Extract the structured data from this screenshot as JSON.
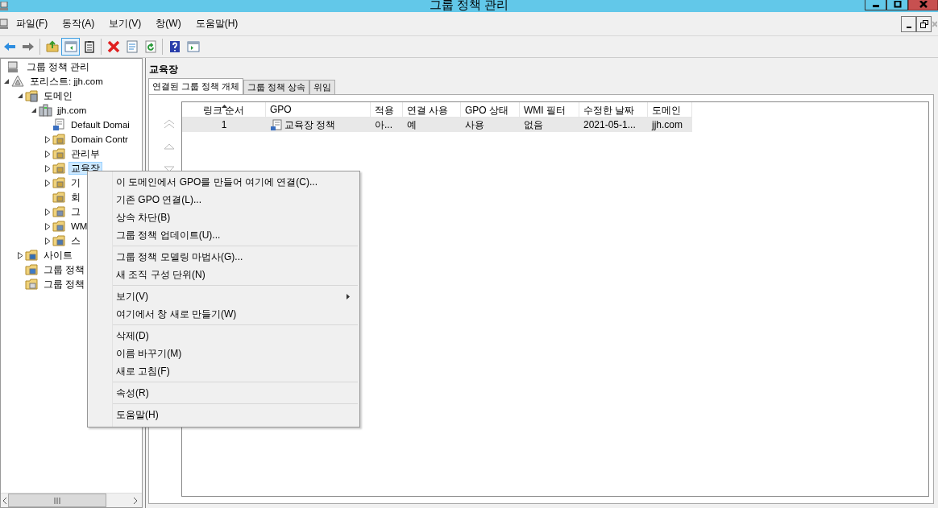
{
  "window": {
    "title": "그룹 정책 관리"
  },
  "menu_bar": [
    "파일(F)",
    "동작(A)",
    "보기(V)",
    "창(W)",
    "도움말(H)"
  ],
  "toolbar": [
    {
      "kind": "back",
      "pressed": false
    },
    {
      "kind": "forward",
      "pressed": false
    },
    {
      "kind": "separator"
    },
    {
      "kind": "folder-up",
      "pressed": false
    },
    {
      "kind": "tree-pane",
      "pressed": true
    },
    {
      "kind": "clipboard",
      "pressed": false
    },
    {
      "kind": "separator"
    },
    {
      "kind": "delete",
      "pressed": false
    },
    {
      "kind": "properties",
      "pressed": false
    },
    {
      "kind": "refresh",
      "pressed": false
    },
    {
      "kind": "separator"
    },
    {
      "kind": "help",
      "pressed": false
    },
    {
      "kind": "action-pane",
      "pressed": false
    }
  ],
  "tree": [
    {
      "label": "그룹 정책 관리",
      "kind": "console",
      "selected": false,
      "children": [
        {
          "label": "포리스트: jjh.com",
          "kind": "forest",
          "selected": false,
          "expanded": true,
          "children": [
            {
              "label": "도메인",
              "kind": "domains",
              "selected": false,
              "expanded": true,
              "children": [
                {
                  "label": "jjh.com",
                  "kind": "domain",
                  "selected": false,
                  "expanded": true,
                  "children": [
                    {
                      "label": "Default Domai",
                      "kind": "gpo-link",
                      "selected": false
                    },
                    {
                      "label": "Domain Contr",
                      "kind": "ou",
                      "selected": false,
                      "expanded": false
                    },
                    {
                      "label": "관리부",
                      "kind": "ou",
                      "selected": false,
                      "expanded": false
                    },
                    {
                      "label": "교육장",
                      "kind": "ou",
                      "selected": true,
                      "expanded": false
                    },
                    {
                      "label": "기",
                      "kind": "ou",
                      "selected": false,
                      "expanded": false
                    },
                    {
                      "label": "회",
                      "kind": "ou",
                      "selected": false
                    },
                    {
                      "label": "그",
                      "kind": "gpo-folder",
                      "selected": false,
                      "expanded": false
                    },
                    {
                      "label": "WM",
                      "kind": "wmi-folder",
                      "selected": false,
                      "expanded": false
                    },
                    {
                      "label": "스",
                      "kind": "starter-folder",
                      "selected": false,
                      "expanded": false
                    }
                  ]
                }
              ]
            },
            {
              "label": "사이트",
              "kind": "sites",
              "selected": false,
              "expanded": false
            },
            {
              "label": "그룹 정책",
              "kind": "modeling",
              "selected": false
            },
            {
              "label": "그룹 정책",
              "kind": "results",
              "selected": false
            }
          ]
        }
      ]
    }
  ],
  "details": {
    "heading": "교육장",
    "tabs": [
      {
        "label": "연결된 그룹 정책 개체",
        "selected": true
      },
      {
        "label": "그룹 정책 상속",
        "selected": false
      },
      {
        "label": "위임",
        "selected": false
      }
    ],
    "order_buttons": [
      {
        "kind": "top"
      },
      {
        "kind": "up"
      },
      {
        "kind": "down"
      }
    ],
    "table": {
      "columns": [
        {
          "label": "링크 순서",
          "sorted": true
        },
        {
          "label": "GPO"
        },
        {
          "label": "적용"
        },
        {
          "label": "연결 사용"
        },
        {
          "label": "GPO 상태"
        },
        {
          "label": "WMI 필터"
        },
        {
          "label": "수정한 날짜"
        },
        {
          "label": "도메인"
        }
      ],
      "rows": [
        {
          "selected": true,
          "cells": [
            "1",
            "교육장 정책",
            "아...",
            "예",
            "사용",
            "없음",
            "2021-05-1...",
            "jjh.com"
          ]
        }
      ]
    }
  },
  "context_menu": [
    {
      "kind": "item",
      "label": "이 도메인에서 GPO를 만들어 여기에 연결(C)..."
    },
    {
      "kind": "item",
      "label": "기존 GPO 연결(L)..."
    },
    {
      "kind": "item",
      "label": "상속 차단(B)"
    },
    {
      "kind": "item",
      "label": "그룹 정책 업데이트(U)..."
    },
    {
      "kind": "separator"
    },
    {
      "kind": "item",
      "label": "그룹 정책 모델링 마법사(G)..."
    },
    {
      "kind": "item",
      "label": "새 조직 구성 단위(N)"
    },
    {
      "kind": "separator"
    },
    {
      "kind": "submenu",
      "label": "보기(V)"
    },
    {
      "kind": "item",
      "label": "여기에서 창 새로 만들기(W)"
    },
    {
      "kind": "separator"
    },
    {
      "kind": "item",
      "label": "삭제(D)"
    },
    {
      "kind": "item",
      "label": "이름 바꾸기(M)"
    },
    {
      "kind": "item",
      "label": "새로 고침(F)"
    },
    {
      "kind": "separator"
    },
    {
      "kind": "item",
      "label": "속성(R)"
    },
    {
      "kind": "separator"
    },
    {
      "kind": "item",
      "label": "도움말(H)"
    }
  ]
}
